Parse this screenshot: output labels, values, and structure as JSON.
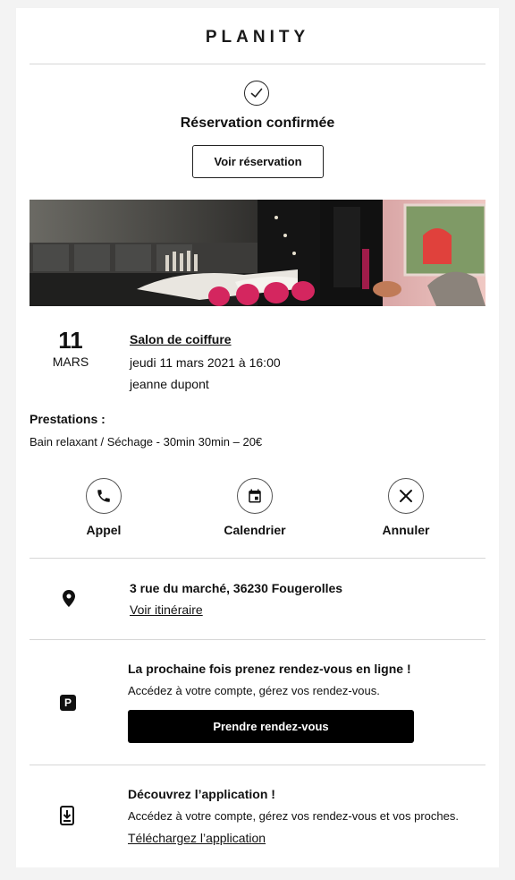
{
  "brand": {
    "logo_text": "PLANITY"
  },
  "confirmation": {
    "title": "Réservation confirmée",
    "view_button": "Voir réservation"
  },
  "appointment": {
    "day": "11",
    "month": "MARS",
    "salon_name": "Salon de coiffure",
    "datetime": "jeudi 11 mars 2021 à 16:00",
    "client_name": "jeanne dupont"
  },
  "services": {
    "title": "Prestations :",
    "items": [
      "Bain relaxant / Séchage - 30min 30min – 20€"
    ]
  },
  "actions": [
    {
      "label": "Appel",
      "icon": "phone-icon"
    },
    {
      "label": "Calendrier",
      "icon": "calendar-icon"
    },
    {
      "label": "Annuler",
      "icon": "close-icon"
    }
  ],
  "location": {
    "address": "3 rue du marché, 36230 Fougerolles",
    "directions_link": "Voir itinéraire",
    "icon": "location-pin-icon"
  },
  "promo": {
    "title": "La prochaine fois prenez rendez-vous en ligne !",
    "subtitle": "Accédez à votre compte, gérez vos rendez-vous.",
    "button": "Prendre rendez-vous",
    "icon_letter": "P"
  },
  "app": {
    "title": "Découvrez l’application !",
    "subtitle": "Accédez à votre compte, gérez vos rendez-vous et vos proches.",
    "download_link": "Téléchargez l’application",
    "icon": "phone-download-icon"
  }
}
